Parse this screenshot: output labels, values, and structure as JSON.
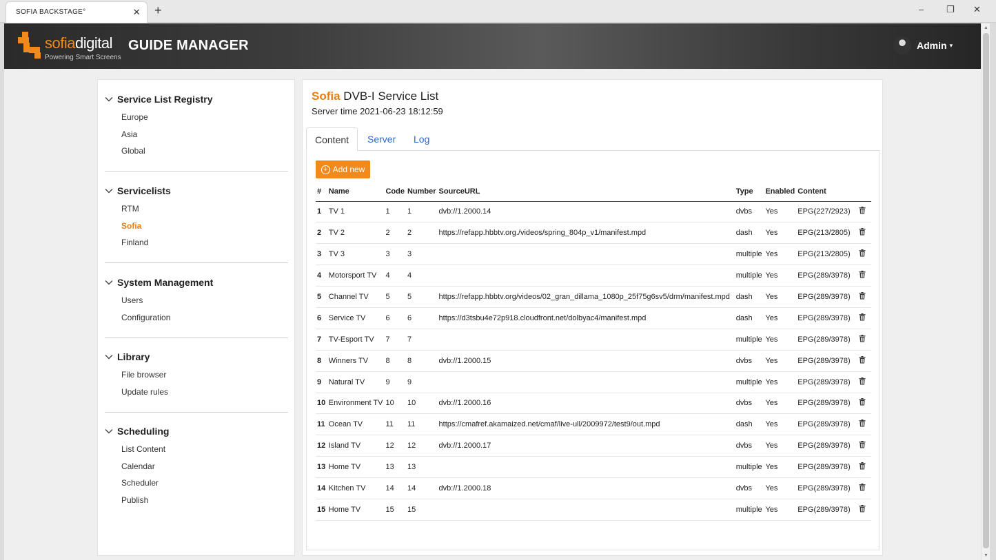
{
  "browser": {
    "tab_title": "SOFIA BACKSTAGE°",
    "close_glyph": "✕",
    "newtab_glyph": "+",
    "minimize_glyph": "–",
    "restore_glyph": "❐",
    "close_window_glyph": "✕"
  },
  "header": {
    "brand_prefix": "sofia",
    "brand_suffix": "digital",
    "tagline": "Powering Smart Screens",
    "app_title": "GUIDE MANAGER",
    "user_name": "Admin",
    "user_caret": "▾",
    "brand_color": "#f08a1c"
  },
  "sidebar": {
    "sections": [
      {
        "title": "Service List Registry",
        "items": [
          "Europe",
          "Asia",
          "Global"
        ]
      },
      {
        "title": "Servicelists",
        "items": [
          "RTM",
          "Sofia",
          "Finland"
        ],
        "active": "Sofia"
      },
      {
        "title": "System Management",
        "items": [
          "Users",
          "Configuration"
        ]
      },
      {
        "title": "Library",
        "items": [
          "File browser",
          "Update rules"
        ]
      },
      {
        "title": "Scheduling",
        "items": [
          "List Content",
          "Calendar",
          "Scheduler",
          "Publish"
        ]
      }
    ]
  },
  "main": {
    "title_accent": "Sofia",
    "title_rest": " DVB-I Service List",
    "server_time": "Server time 2021-06-23 18:12:59",
    "tabs": [
      "Content",
      "Server",
      "Log"
    ],
    "active_tab": "Content",
    "add_button": "Add new",
    "columns": [
      "#",
      "Name",
      "Code",
      "Number",
      "SourceURL",
      "Type",
      "Enabled",
      "Content",
      ""
    ],
    "rows": [
      {
        "n": "1",
        "name": "TV 1",
        "code": "1",
        "number": "1",
        "url": "dvb://1.2000.14",
        "type": "dvbs",
        "enabled": "Yes",
        "content": "EPG(227/2923)"
      },
      {
        "n": "2",
        "name": "TV 2",
        "code": "2",
        "number": "2",
        "url": "https://refapp.hbbtv.org./videos/spring_804p_v1/manifest.mpd",
        "type": "dash",
        "enabled": "Yes",
        "content": "EPG(213/2805)"
      },
      {
        "n": "3",
        "name": "TV 3",
        "code": "3",
        "number": "3",
        "url": "",
        "type": "multiple",
        "enabled": "Yes",
        "content": "EPG(213/2805)"
      },
      {
        "n": "4",
        "name": "Motorsport TV",
        "code": "4",
        "number": "4",
        "url": "",
        "type": "multiple",
        "enabled": "Yes",
        "content": "EPG(289/3978)"
      },
      {
        "n": "5",
        "name": "Channel TV",
        "code": "5",
        "number": "5",
        "url": "https://refapp.hbbtv.org/videos/02_gran_dillama_1080p_25f75g6sv5/drm/manifest.mpd",
        "type": "dash",
        "enabled": "Yes",
        "content": "EPG(289/3978)"
      },
      {
        "n": "6",
        "name": "Service TV",
        "code": "6",
        "number": "6",
        "url": "https://d3tsbu4e72p918.cloudfront.net/dolbyac4/manifest.mpd",
        "type": "dash",
        "enabled": "Yes",
        "content": "EPG(289/3978)"
      },
      {
        "n": "7",
        "name": "TV-Esport TV",
        "code": "7",
        "number": "7",
        "url": "",
        "type": "multiple",
        "enabled": "Yes",
        "content": "EPG(289/3978)"
      },
      {
        "n": "8",
        "name": "Winners TV",
        "code": "8",
        "number": "8",
        "url": "dvb://1.2000.15",
        "type": "dvbs",
        "enabled": "Yes",
        "content": "EPG(289/3978)"
      },
      {
        "n": "9",
        "name": "Natural TV",
        "code": "9",
        "number": "9",
        "url": "",
        "type": "multiple",
        "enabled": "Yes",
        "content": "EPG(289/3978)"
      },
      {
        "n": "10",
        "name": "Environment TV",
        "code": "10",
        "number": "10",
        "url": "dvb://1.2000.16",
        "type": "dvbs",
        "enabled": "Yes",
        "content": "EPG(289/3978)"
      },
      {
        "n": "11",
        "name": "Ocean TV",
        "code": "11",
        "number": "11",
        "url": "https://cmafref.akamaized.net/cmaf/live-ull/2009972/test9/out.mpd",
        "type": "dash",
        "enabled": "Yes",
        "content": "EPG(289/3978)"
      },
      {
        "n": "12",
        "name": "Island TV",
        "code": "12",
        "number": "12",
        "url": "dvb://1.2000.17",
        "type": "dvbs",
        "enabled": "Yes",
        "content": "EPG(289/3978)"
      },
      {
        "n": "13",
        "name": "Home TV",
        "code": "13",
        "number": "13",
        "url": "",
        "type": "multiple",
        "enabled": "Yes",
        "content": "EPG(289/3978)"
      },
      {
        "n": "14",
        "name": "Kitchen TV",
        "code": "14",
        "number": "14",
        "url": "dvb://1.2000.18",
        "type": "dvbs",
        "enabled": "Yes",
        "content": "EPG(289/3978)"
      },
      {
        "n": "15",
        "name": "Home TV",
        "code": "15",
        "number": "15",
        "url": "",
        "type": "multiple",
        "enabled": "Yes",
        "content": "EPG(289/3978)"
      }
    ]
  }
}
